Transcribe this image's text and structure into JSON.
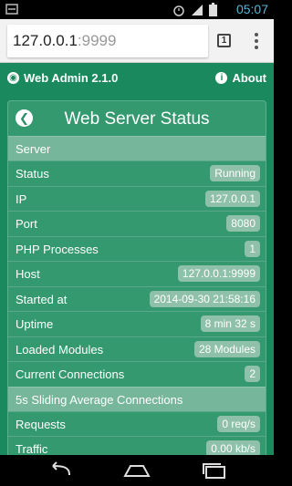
{
  "statusbar": {
    "time": "05:07"
  },
  "browser": {
    "url_host": "127.0.0.1",
    "url_port": ":9999",
    "tab_count": "1"
  },
  "app": {
    "title": "Web Admin 2.1.0",
    "about_label": "About"
  },
  "panel": {
    "title": "Web Server Status",
    "sections": [
      {
        "title": "Server",
        "rows": [
          {
            "label": "Status",
            "value": "Running"
          },
          {
            "label": "IP",
            "value": "127.0.0.1"
          },
          {
            "label": "Port",
            "value": "8080"
          },
          {
            "label": "PHP Processes",
            "value": "1"
          },
          {
            "label": "Host",
            "value": "127.0.0.1:9999"
          },
          {
            "label": "Started at",
            "value": "2014-09-30 21:58:16"
          },
          {
            "label": "Uptime",
            "value": "8 min 32 s"
          },
          {
            "label": "Loaded Modules",
            "value": "28 Modules"
          },
          {
            "label": "Current Connections",
            "value": "2"
          }
        ]
      },
      {
        "title": "5s Sliding Average Connections",
        "rows": [
          {
            "label": "Requests",
            "value": "0 req/s"
          },
          {
            "label": "Traffic",
            "value": "0.00 kb/s"
          }
        ]
      }
    ]
  },
  "colors": {
    "page_bg": "#1a8a5e",
    "panel_bg": "#35996f",
    "section_bg": "#76b69b",
    "badge_bg": "#8fc0a9",
    "clock": "#5ab4d6"
  },
  "icons": {
    "status": [
      "notification-icon",
      "alarm-icon",
      "signal-icon",
      "battery-icon"
    ],
    "brand": "globe-icon",
    "about": "info-icon",
    "back": "back-arrow-icon",
    "nav": [
      "nav-back-icon",
      "nav-home-icon",
      "nav-recents-icon"
    ]
  }
}
